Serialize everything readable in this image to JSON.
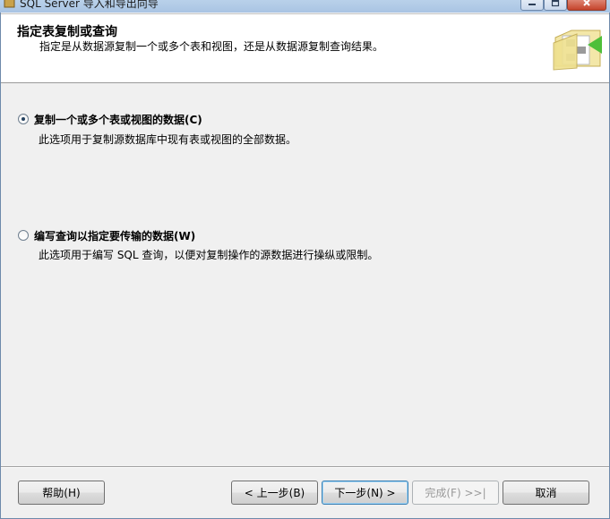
{
  "window": {
    "title": "SQL Server 导入和导出向导"
  },
  "header": {
    "title": "指定表复制或查询",
    "description": "指定是从数据源复制一个或多个表和视图，还是从数据源复制查询结果。"
  },
  "options": [
    {
      "label": "复制一个或多个表或视图的数据(C)",
      "description": "此选项用于复制源数据库中现有表或视图的全部数据。",
      "selected": true
    },
    {
      "label": "编写查询以指定要传输的数据(W)",
      "description": "此选项用于编写 SQL 查询，以便对复制操作的源数据进行操纵或限制。",
      "selected": false
    }
  ],
  "buttons": {
    "help": "帮助(H)",
    "back": "< 上一步(B)",
    "next": "下一步(N) >",
    "finish": "完成(F) >>|",
    "cancel": "取消"
  },
  "colors": {
    "titlebar": "#b9d1ea",
    "close_button": "#c5432b",
    "header_bg": "#ffffff",
    "body_bg": "#f0f0f0"
  },
  "icons": [
    "app-icon",
    "minimize-icon",
    "maximize-icon",
    "close-icon",
    "wizard-folder-icon"
  ]
}
